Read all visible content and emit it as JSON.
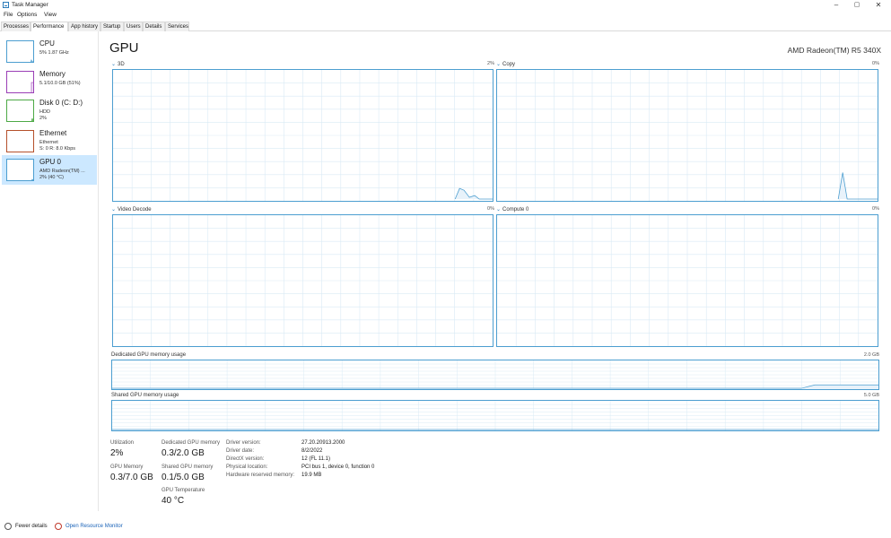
{
  "window": {
    "title": "Task Manager",
    "minimize": "–",
    "maximize": "▢",
    "close": "✕"
  },
  "menu": [
    "File",
    "Options",
    "View"
  ],
  "tabs": [
    "Processes",
    "Performance",
    "App history",
    "Startup",
    "Users",
    "Details",
    "Services"
  ],
  "active_tab": "Performance",
  "sidebar": {
    "items": [
      {
        "title": "CPU",
        "lines": [
          "5% 1.87 GHz"
        ],
        "color": "#4c9ed0"
      },
      {
        "title": "Memory",
        "lines": [
          "5.1/10.0 GB (51%)"
        ],
        "color": "#9a3eb6"
      },
      {
        "title": "Disk 0 (C: D:)",
        "lines": [
          "HDD",
          "2%"
        ],
        "color": "#4da946"
      },
      {
        "title": "Ethernet",
        "lines": [
          "Ethernet",
          "S: 0 R: 8.0 Kbps"
        ],
        "color": "#b5502b"
      },
      {
        "title": "GPU 0",
        "lines": [
          "AMD Radeon(TM) ...",
          "2% (40 °C)"
        ],
        "color": "#4c9ed0"
      }
    ]
  },
  "main": {
    "title": "GPU",
    "device": "AMD Radeon(TM) R5 340X",
    "graphs": [
      {
        "label": "3D",
        "pct": "2%"
      },
      {
        "label": "Copy",
        "pct": "0%"
      },
      {
        "label": "Video Decode",
        "pct": "0%"
      },
      {
        "label": "Compute 0",
        "pct": "0%"
      }
    ],
    "dedicated_memory_graph": {
      "label": "Dedicated GPU memory usage",
      "max": "2.0 GB"
    },
    "shared_memory_graph": {
      "label": "Shared GPU memory usage",
      "max": "5.0 GB"
    },
    "stats": {
      "utilization_label": "Utilization",
      "utilization": "2%",
      "dedicated_label": "Dedicated GPU memory",
      "dedicated": "0.3/2.0 GB",
      "gpu_memory_label": "GPU Memory",
      "gpu_memory": "0.3/7.0 GB",
      "shared_label": "Shared GPU memory",
      "shared": "0.1/5.0 GB",
      "temp_label": "GPU Temperature",
      "temp": "40 °C"
    },
    "details": [
      {
        "key": "Driver version:",
        "value": "27.20.20913.2000"
      },
      {
        "key": "Driver date:",
        "value": "8/2/2022"
      },
      {
        "key": "DirectX version:",
        "value": "12 (FL 11.1)"
      },
      {
        "key": "Physical location:",
        "value": "PCI bus 1, device 0, function 0"
      },
      {
        "key": "Hardware reserved memory:",
        "value": "19.9 MB"
      }
    ]
  },
  "footer": {
    "fewer_details": "Fewer details",
    "open_monitor": "Open Resource Monitor"
  }
}
